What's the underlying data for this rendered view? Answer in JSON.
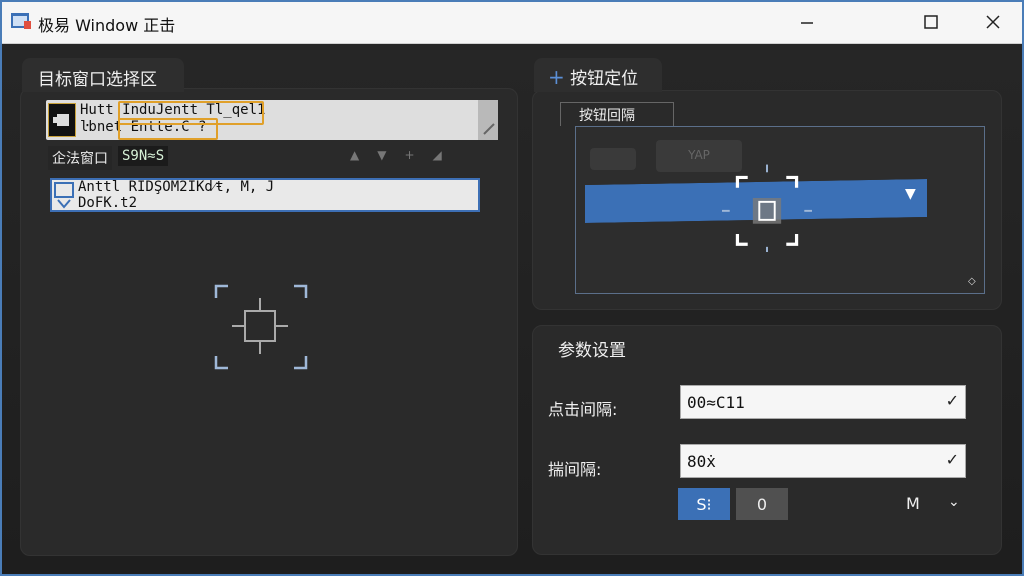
{
  "window": {
    "title": "极易 Window 正击",
    "minimize_icon": "minimize-icon",
    "maximize_icon": "maximize-icon",
    "close_icon": "close-icon"
  },
  "left_panel": {
    "tab_label": "目标窗口选择区",
    "row1": {
      "line1": "Hutt InduJentt Tl_qel1",
      "line2": "ŀbnet Entte.C ?"
    },
    "row2": {
      "label": "企法窗口",
      "badge": "S9N≈S"
    },
    "row3": {
      "line1": "Anttl RIDŞOM2IKd⁄ŧ, M, J",
      "line2": "DoFK.t2"
    }
  },
  "right_top_panel": {
    "tab_label": "按钮定位",
    "add_icon": "plus-icon",
    "subtab_label": "按钮回隔",
    "ghost_chip_text": "YAP"
  },
  "right_bottom_panel": {
    "title": "参数设置",
    "click_interval_label": "点击间隔:",
    "click_interval_value": "00≈C11",
    "interval2_label": "揣间隔:",
    "interval2_value": "80ẋ",
    "btn_s_label": "S⁝",
    "btn_zero_label": "0",
    "unit_label": "M"
  },
  "colors": {
    "accent_blue": "#3b70b6",
    "highlight_orange": "#e0a02a",
    "panel_bg": "#2a2a2a"
  }
}
